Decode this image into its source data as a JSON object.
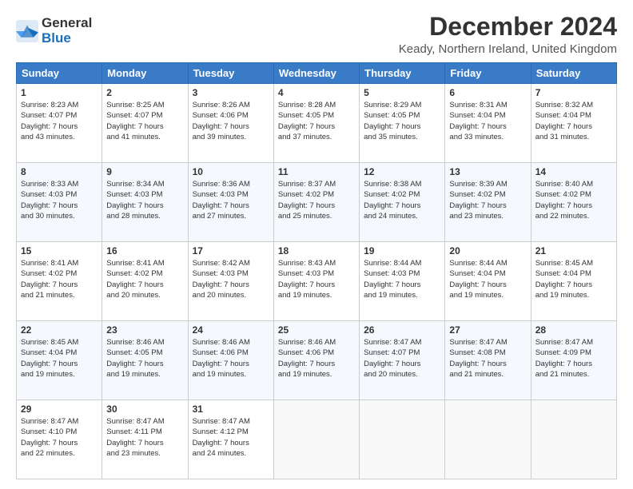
{
  "header": {
    "logo_line1": "General",
    "logo_line2": "Blue",
    "title": "December 2024",
    "subtitle": "Keady, Northern Ireland, United Kingdom"
  },
  "days_of_week": [
    "Sunday",
    "Monday",
    "Tuesday",
    "Wednesday",
    "Thursday",
    "Friday",
    "Saturday"
  ],
  "weeks": [
    [
      {
        "day": "1",
        "sunrise": "8:23 AM",
        "sunset": "4:07 PM",
        "daylight": "7 hours and 43 minutes."
      },
      {
        "day": "2",
        "sunrise": "8:25 AM",
        "sunset": "4:07 PM",
        "daylight": "7 hours and 41 minutes."
      },
      {
        "day": "3",
        "sunrise": "8:26 AM",
        "sunset": "4:06 PM",
        "daylight": "7 hours and 39 minutes."
      },
      {
        "day": "4",
        "sunrise": "8:28 AM",
        "sunset": "4:05 PM",
        "daylight": "7 hours and 37 minutes."
      },
      {
        "day": "5",
        "sunrise": "8:29 AM",
        "sunset": "4:05 PM",
        "daylight": "7 hours and 35 minutes."
      },
      {
        "day": "6",
        "sunrise": "8:31 AM",
        "sunset": "4:04 PM",
        "daylight": "7 hours and 33 minutes."
      },
      {
        "day": "7",
        "sunrise": "8:32 AM",
        "sunset": "4:04 PM",
        "daylight": "7 hours and 31 minutes."
      }
    ],
    [
      {
        "day": "8",
        "sunrise": "8:33 AM",
        "sunset": "4:03 PM",
        "daylight": "7 hours and 30 minutes."
      },
      {
        "day": "9",
        "sunrise": "8:34 AM",
        "sunset": "4:03 PM",
        "daylight": "7 hours and 28 minutes."
      },
      {
        "day": "10",
        "sunrise": "8:36 AM",
        "sunset": "4:03 PM",
        "daylight": "7 hours and 27 minutes."
      },
      {
        "day": "11",
        "sunrise": "8:37 AM",
        "sunset": "4:02 PM",
        "daylight": "7 hours and 25 minutes."
      },
      {
        "day": "12",
        "sunrise": "8:38 AM",
        "sunset": "4:02 PM",
        "daylight": "7 hours and 24 minutes."
      },
      {
        "day": "13",
        "sunrise": "8:39 AM",
        "sunset": "4:02 PM",
        "daylight": "7 hours and 23 minutes."
      },
      {
        "day": "14",
        "sunrise": "8:40 AM",
        "sunset": "4:02 PM",
        "daylight": "7 hours and 22 minutes."
      }
    ],
    [
      {
        "day": "15",
        "sunrise": "8:41 AM",
        "sunset": "4:02 PM",
        "daylight": "7 hours and 21 minutes."
      },
      {
        "day": "16",
        "sunrise": "8:41 AM",
        "sunset": "4:02 PM",
        "daylight": "7 hours and 20 minutes."
      },
      {
        "day": "17",
        "sunrise": "8:42 AM",
        "sunset": "4:03 PM",
        "daylight": "7 hours and 20 minutes."
      },
      {
        "day": "18",
        "sunrise": "8:43 AM",
        "sunset": "4:03 PM",
        "daylight": "7 hours and 19 minutes."
      },
      {
        "day": "19",
        "sunrise": "8:44 AM",
        "sunset": "4:03 PM",
        "daylight": "7 hours and 19 minutes."
      },
      {
        "day": "20",
        "sunrise": "8:44 AM",
        "sunset": "4:04 PM",
        "daylight": "7 hours and 19 minutes."
      },
      {
        "day": "21",
        "sunrise": "8:45 AM",
        "sunset": "4:04 PM",
        "daylight": "7 hours and 19 minutes."
      }
    ],
    [
      {
        "day": "22",
        "sunrise": "8:45 AM",
        "sunset": "4:04 PM",
        "daylight": "7 hours and 19 minutes."
      },
      {
        "day": "23",
        "sunrise": "8:46 AM",
        "sunset": "4:05 PM",
        "daylight": "7 hours and 19 minutes."
      },
      {
        "day": "24",
        "sunrise": "8:46 AM",
        "sunset": "4:06 PM",
        "daylight": "7 hours and 19 minutes."
      },
      {
        "day": "25",
        "sunrise": "8:46 AM",
        "sunset": "4:06 PM",
        "daylight": "7 hours and 19 minutes."
      },
      {
        "day": "26",
        "sunrise": "8:47 AM",
        "sunset": "4:07 PM",
        "daylight": "7 hours and 20 minutes."
      },
      {
        "day": "27",
        "sunrise": "8:47 AM",
        "sunset": "4:08 PM",
        "daylight": "7 hours and 21 minutes."
      },
      {
        "day": "28",
        "sunrise": "8:47 AM",
        "sunset": "4:09 PM",
        "daylight": "7 hours and 21 minutes."
      }
    ],
    [
      {
        "day": "29",
        "sunrise": "8:47 AM",
        "sunset": "4:10 PM",
        "daylight": "7 hours and 22 minutes."
      },
      {
        "day": "30",
        "sunrise": "8:47 AM",
        "sunset": "4:11 PM",
        "daylight": "7 hours and 23 minutes."
      },
      {
        "day": "31",
        "sunrise": "8:47 AM",
        "sunset": "4:12 PM",
        "daylight": "7 hours and 24 minutes."
      },
      null,
      null,
      null,
      null
    ]
  ],
  "labels": {
    "sunrise": "Sunrise:",
    "sunset": "Sunset:",
    "daylight": "Daylight hours"
  }
}
